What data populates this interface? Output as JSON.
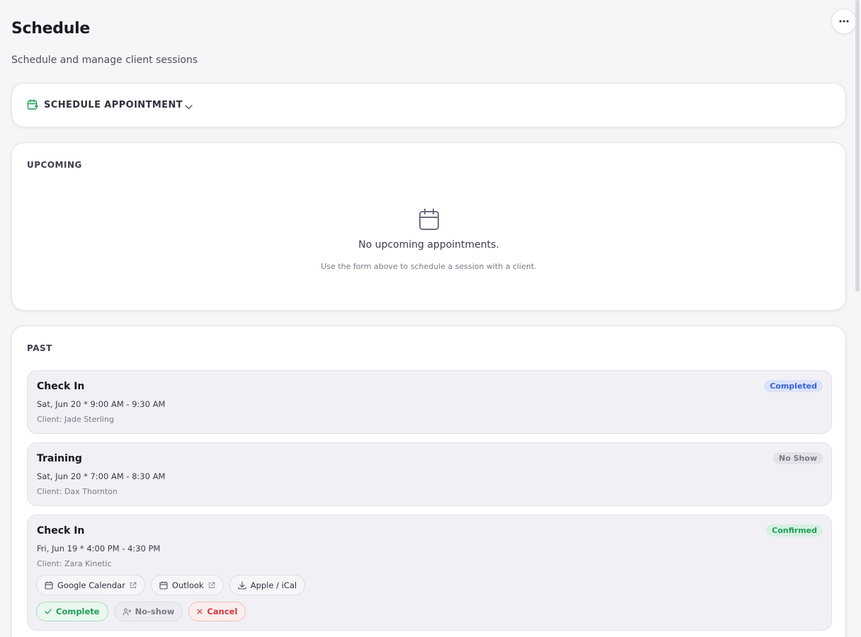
{
  "header": {
    "title": "Schedule",
    "subtitle": "Schedule and manage client sessions",
    "more_icon": "more-horizontal-icon"
  },
  "schedule_form": {
    "label": "SCHEDULE APPOINTMENT",
    "icon": "calendar-plus-icon",
    "toggle_icon": "chevron-down-icon"
  },
  "upcoming": {
    "label": "UPCOMING",
    "empty_icon": "calendar-icon",
    "empty_title": "No upcoming appointments.",
    "empty_hint": "Use the form above to schedule a session with a client."
  },
  "past": {
    "label": "PAST",
    "appointments": [
      {
        "title": "Check In",
        "time": "Sat, Jun 20 * 9:00 AM - 9:30 AM",
        "client": "Client: Jade Sterling",
        "status": "Completed"
      },
      {
        "title": "Training",
        "time": "Sat, Jun 20 * 7:00 AM - 8:30 AM",
        "client": "Client: Dax Thornton",
        "status": "No Show"
      },
      {
        "title": "Check In",
        "time": "Fri, Jun 19 * 4:00 PM - 4:30 PM",
        "client": "Client: Zara Kinetic",
        "status": "Confirmed",
        "calendar_links": {
          "google": "Google Calendar",
          "outlook": "Outlook",
          "apple": "Apple / iCal"
        },
        "actions": {
          "complete": "Complete",
          "noshow": "No-show",
          "cancel": "Cancel"
        }
      }
    ]
  },
  "colors": {
    "accent_green": "#1f9e57",
    "completed_blue": "#3563d4",
    "cancel_red": "#d43a3a",
    "background": "#f6f6f9"
  }
}
